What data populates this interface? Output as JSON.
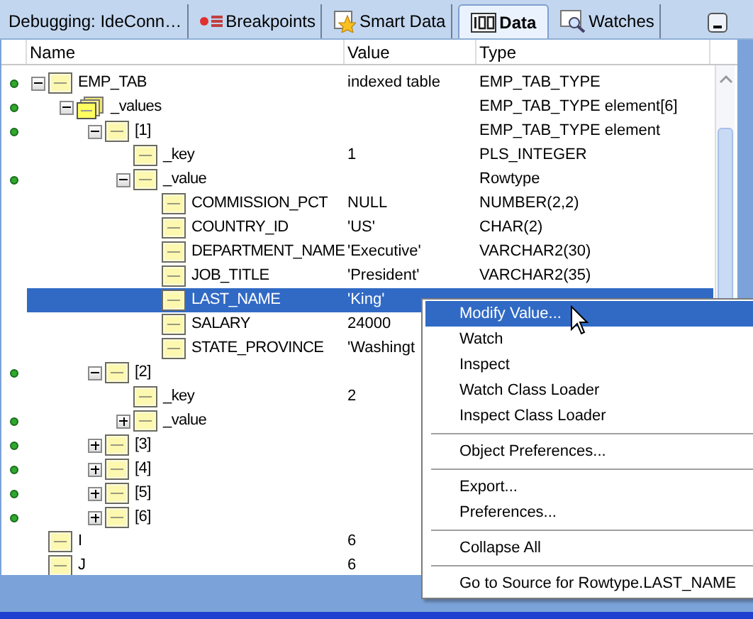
{
  "tabs": [
    {
      "label": "Debugging: IdeConn…",
      "kind": "plain",
      "selected": false
    },
    {
      "label": "Breakpoints",
      "kind": "breakpoints",
      "selected": false
    },
    {
      "label": "Smart Data",
      "kind": "smart",
      "selected": false
    },
    {
      "label": "Data",
      "kind": "data",
      "selected": true
    },
    {
      "label": "Watches",
      "kind": "watches",
      "selected": false
    }
  ],
  "columns": [
    "Name",
    "Value",
    "Type"
  ],
  "tree": [
    {
      "name": "EMP_TAB",
      "value": "indexed table",
      "type": "EMP_TAB_TYPE",
      "marked": true,
      "expanded": true,
      "selected": false,
      "kind": "field",
      "children": [
        {
          "name": "_values",
          "type": "EMP_TAB_TYPE element[6]",
          "marked": true,
          "expanded": true,
          "selected": false,
          "kind": "array",
          "children": [
            {
              "name": "[1]",
              "type": "EMP_TAB_TYPE element",
              "marked": true,
              "expanded": true,
              "selected": false,
              "kind": "field",
              "children": [
                {
                  "name": "_key",
                  "value": "1",
                  "type": "PLS_INTEGER",
                  "marked": false,
                  "selected": false,
                  "kind": "field"
                },
                {
                  "name": "_value",
                  "type": "Rowtype",
                  "marked": true,
                  "expanded": true,
                  "selected": false,
                  "kind": "field",
                  "children": [
                    {
                      "name": "COMMISSION_PCT",
                      "value": "NULL",
                      "type": "NUMBER(2,2)",
                      "marked": false,
                      "selected": false,
                      "kind": "field"
                    },
                    {
                      "name": "COUNTRY_ID",
                      "value": "'US'",
                      "type": "CHAR(2)",
                      "marked": false,
                      "selected": false,
                      "kind": "field"
                    },
                    {
                      "name": "DEPARTMENT_NAME",
                      "value": "'Executive'",
                      "type": "VARCHAR2(30)",
                      "marked": false,
                      "selected": false,
                      "kind": "field"
                    },
                    {
                      "name": "JOB_TITLE",
                      "value": "'President'",
                      "type": "VARCHAR2(35)",
                      "marked": false,
                      "selected": false,
                      "kind": "field"
                    },
                    {
                      "name": "LAST_NAME",
                      "value": "'King'",
                      "marked": false,
                      "selected": true,
                      "kind": "field"
                    },
                    {
                      "name": "SALARY",
                      "value": "24000",
                      "marked": false,
                      "selected": false,
                      "kind": "field"
                    },
                    {
                      "name": "STATE_PROVINCE",
                      "value": "'Washingt",
                      "marked": false,
                      "selected": false,
                      "kind": "field"
                    }
                  ]
                }
              ]
            },
            {
              "name": "[2]",
              "marked": true,
              "expanded": true,
              "selected": false,
              "kind": "field",
              "children": [
                {
                  "name": "_key",
                  "value": "2",
                  "marked": false,
                  "selected": false,
                  "kind": "field"
                },
                {
                  "name": "_value",
                  "marked": true,
                  "expanded": false,
                  "selected": false,
                  "kind": "field"
                }
              ]
            },
            {
              "name": "[3]",
              "marked": true,
              "expanded": false,
              "selected": false,
              "kind": "field"
            },
            {
              "name": "[4]",
              "marked": true,
              "expanded": false,
              "selected": false,
              "kind": "field"
            },
            {
              "name": "[5]",
              "marked": true,
              "expanded": false,
              "selected": false,
              "kind": "field"
            },
            {
              "name": "[6]",
              "marked": true,
              "expanded": false,
              "selected": false,
              "kind": "field"
            }
          ]
        }
      ]
    },
    {
      "name": "I",
      "value": "6",
      "marked": false,
      "selected": false,
      "kind": "field"
    },
    {
      "name": "J",
      "value": "6",
      "marked": false,
      "selected": false,
      "kind": "field"
    }
  ],
  "context_menu": [
    {
      "kind": "item",
      "label": "Modify Value...",
      "selected": true
    },
    {
      "kind": "item",
      "label": "Watch",
      "selected": false
    },
    {
      "kind": "item",
      "label": "Inspect",
      "selected": false
    },
    {
      "kind": "item",
      "label": "Watch Class Loader",
      "selected": false
    },
    {
      "kind": "item",
      "label": "Inspect Class Loader",
      "selected": false
    },
    {
      "kind": "separator"
    },
    {
      "kind": "item",
      "label": "Object Preferences...",
      "selected": false
    },
    {
      "kind": "separator"
    },
    {
      "kind": "item",
      "label": "Export...",
      "selected": false
    },
    {
      "kind": "item",
      "label": "Preferences...",
      "selected": false
    },
    {
      "kind": "separator"
    },
    {
      "kind": "item",
      "label": "Collapse All",
      "selected": false
    },
    {
      "kind": "separator"
    },
    {
      "kind": "item",
      "label": "Go to Source for Rowtype.LAST_NAME",
      "selected": false
    }
  ]
}
